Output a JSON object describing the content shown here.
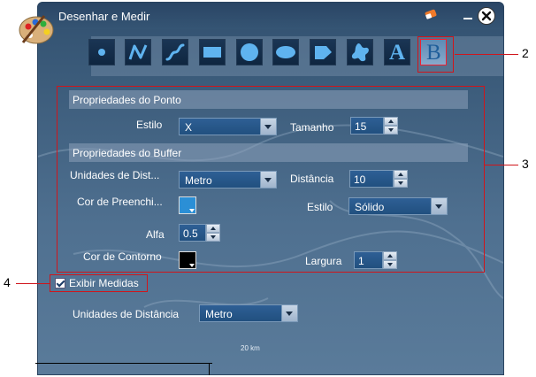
{
  "window": {
    "title": "Desenhar e Medir"
  },
  "toolbar": {
    "tools": [
      {
        "name": "point",
        "icon": "point-icon"
      },
      {
        "name": "polyline",
        "icon": "polyline-icon"
      },
      {
        "name": "freehand-line",
        "icon": "freehand-line-icon"
      },
      {
        "name": "rectangle",
        "icon": "rectangle-icon"
      },
      {
        "name": "circle",
        "icon": "circle-icon"
      },
      {
        "name": "ellipse",
        "icon": "ellipse-icon"
      },
      {
        "name": "polygon",
        "icon": "polygon-icon"
      },
      {
        "name": "freehand-polygon",
        "icon": "freehand-polygon-icon"
      },
      {
        "name": "text",
        "icon": "text-icon",
        "glyph": "A"
      },
      {
        "name": "buffer",
        "icon": "buffer-icon",
        "glyph": "B",
        "selected": true
      }
    ]
  },
  "point_props": {
    "header": "Propriedades do Ponto",
    "style_label": "Estilo",
    "style_value": "X",
    "size_label": "Tamanho",
    "size_value": "15"
  },
  "buffer_props": {
    "header": "Propriedades do Buffer",
    "units_label": "Unidades de Dist...",
    "units_value": "Metro",
    "distance_label": "Distância",
    "distance_value": "10",
    "fill_label": "Cor de Preenchi...",
    "fill_color": "#2b8fd6",
    "style_label": "Estilo",
    "style_value": "Sólido",
    "alpha_label": "Alfa",
    "alpha_value": "0.5",
    "outline_label": "Cor de Contorno",
    "outline_color": "#000000",
    "width_label": "Largura",
    "width_value": "1"
  },
  "measure": {
    "show_label": "Exibir Medidas",
    "checked": true,
    "units_label": "Unidades de Distância",
    "units_value": "Metro"
  },
  "map": {
    "scale_label": "20 km"
  },
  "callouts": {
    "two": "2",
    "three": "3",
    "four": "4"
  },
  "colors": {
    "callout": "#d0151b"
  }
}
